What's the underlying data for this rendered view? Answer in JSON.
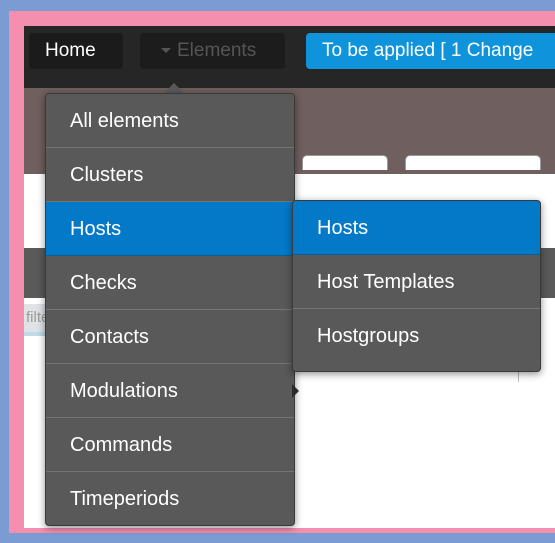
{
  "navbar": {
    "home_label": "Home",
    "elements_label": "Elements",
    "apply_label": "To be applied [ 1 Change"
  },
  "filter_placeholder": "filter",
  "elements_menu": {
    "items": [
      {
        "label": "All elements"
      },
      {
        "label": "Clusters"
      },
      {
        "label": "Hosts",
        "active": true
      },
      {
        "label": "Checks"
      },
      {
        "label": "Contacts"
      },
      {
        "label": "Modulations"
      },
      {
        "label": "Commands"
      },
      {
        "label": "Timeperiods"
      }
    ]
  },
  "hosts_submenu": {
    "items": [
      {
        "label": "Hosts",
        "active": true
      },
      {
        "label": "Host Templates"
      },
      {
        "label": "Hostgroups"
      }
    ]
  },
  "colors": {
    "accent_blue": "#0379c8",
    "apply_blue": "#0f94dc",
    "frame_pink": "#f58fb0",
    "menu_gray": "#595959"
  }
}
